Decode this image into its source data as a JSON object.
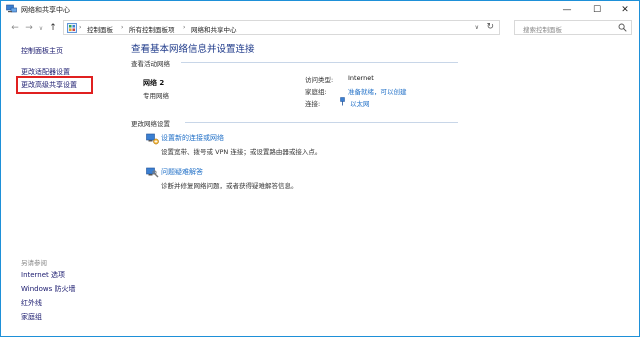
{
  "window": {
    "title": "网络和共享中心",
    "minimize_glyph": "—",
    "maximize_glyph": "☐",
    "close_glyph": "✕",
    "icon": "network-center-icon"
  },
  "address_bar": {
    "back_glyph": "←",
    "forward_glyph": "→",
    "history_glyph": "∨",
    "up_glyph": "↑",
    "crumbs": [
      "控制面板",
      "所有控制面板项",
      "网络和共享中心"
    ],
    "separator": "›",
    "dropdown_glyph": "∨",
    "refresh_glyph": "↻",
    "search_placeholder": "搜索控制面板"
  },
  "left_pane": {
    "home": "控制面板主页",
    "adapter_settings": "更改适配器设置",
    "advanced_sharing": "更改高级共享设置",
    "see_also_title": "另请参阅",
    "see_also": [
      "Internet 选项",
      "Windows 防火墙",
      "红外线",
      "家庭组"
    ]
  },
  "main": {
    "title": "查看基本网络信息并设置连接",
    "active_networks_label": "查看活动网络",
    "network_name": "网络  2",
    "network_type": "专用网络",
    "properties": {
      "access_type_label": "访问类型:",
      "access_type_value": "Internet",
      "homegroup_label": "家庭组:",
      "homegroup_value": "准备就绪，可以创建",
      "connections_label": "连接:",
      "connections_value": "以太网"
    },
    "change_settings_label": "更改网络设置",
    "tasks": [
      {
        "title": "设置新的连接或网络",
        "desc": "设置宽带、拨号或 VPN 连接；或设置路由器或接入点。",
        "icon": "new-connection-icon"
      },
      {
        "title": "问题疑难解答",
        "desc": "诊断并修复网络问题，或者获得疑难解答信息。",
        "icon": "troubleshoot-icon"
      }
    ]
  },
  "colors": {
    "link": "#1f6fc7",
    "title_blue": "#1e3a8a",
    "highlight": "#e02020",
    "window_border": "#1e90d8"
  }
}
